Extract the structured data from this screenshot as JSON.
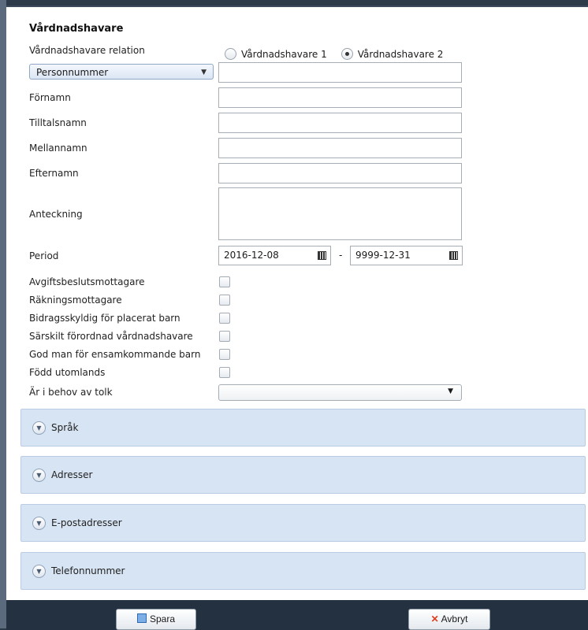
{
  "section": {
    "title": "Vårdnadshavare"
  },
  "relation": {
    "label": "Vårdnadshavare relation",
    "options": [
      {
        "label": "Vårdnadshavare 1",
        "checked": false
      },
      {
        "label": "Vårdnadshavare 2",
        "checked": true
      }
    ]
  },
  "id_type": {
    "selected": "Personnummer",
    "value": ""
  },
  "fields": {
    "fornamn": {
      "label": "Förnamn",
      "value": ""
    },
    "tilltalsnamn": {
      "label": "Tilltalsnamn",
      "value": ""
    },
    "mellannamn": {
      "label": "Mellannamn",
      "value": ""
    },
    "efternamn": {
      "label": "Efternamn",
      "value": ""
    },
    "anteckning": {
      "label": "Anteckning",
      "value": ""
    }
  },
  "period": {
    "label": "Period",
    "from": "2016-12-08",
    "separator": "-",
    "to": "9999-12-31"
  },
  "checkboxes": [
    {
      "label": "Avgiftsbeslutsmottagare",
      "checked": false
    },
    {
      "label": "Räkningsmottagare",
      "checked": false
    },
    {
      "label": "Bidragsskyldig för placerat barn",
      "checked": false
    },
    {
      "label": "Särskilt förordnad vårdnadshavare",
      "checked": false
    },
    {
      "label": "God man för ensamkommande barn",
      "checked": false
    },
    {
      "label": "Född utomlands",
      "checked": false
    }
  ],
  "tolk": {
    "label": "Är i behov av tolk",
    "selected": ""
  },
  "panels": [
    {
      "title": "Språk"
    },
    {
      "title": "Adresser"
    },
    {
      "title": "E-postadresser"
    },
    {
      "title": "Telefonnummer"
    }
  ],
  "footer": {
    "save_label": "Spara",
    "cancel_label": "Avbryt"
  }
}
